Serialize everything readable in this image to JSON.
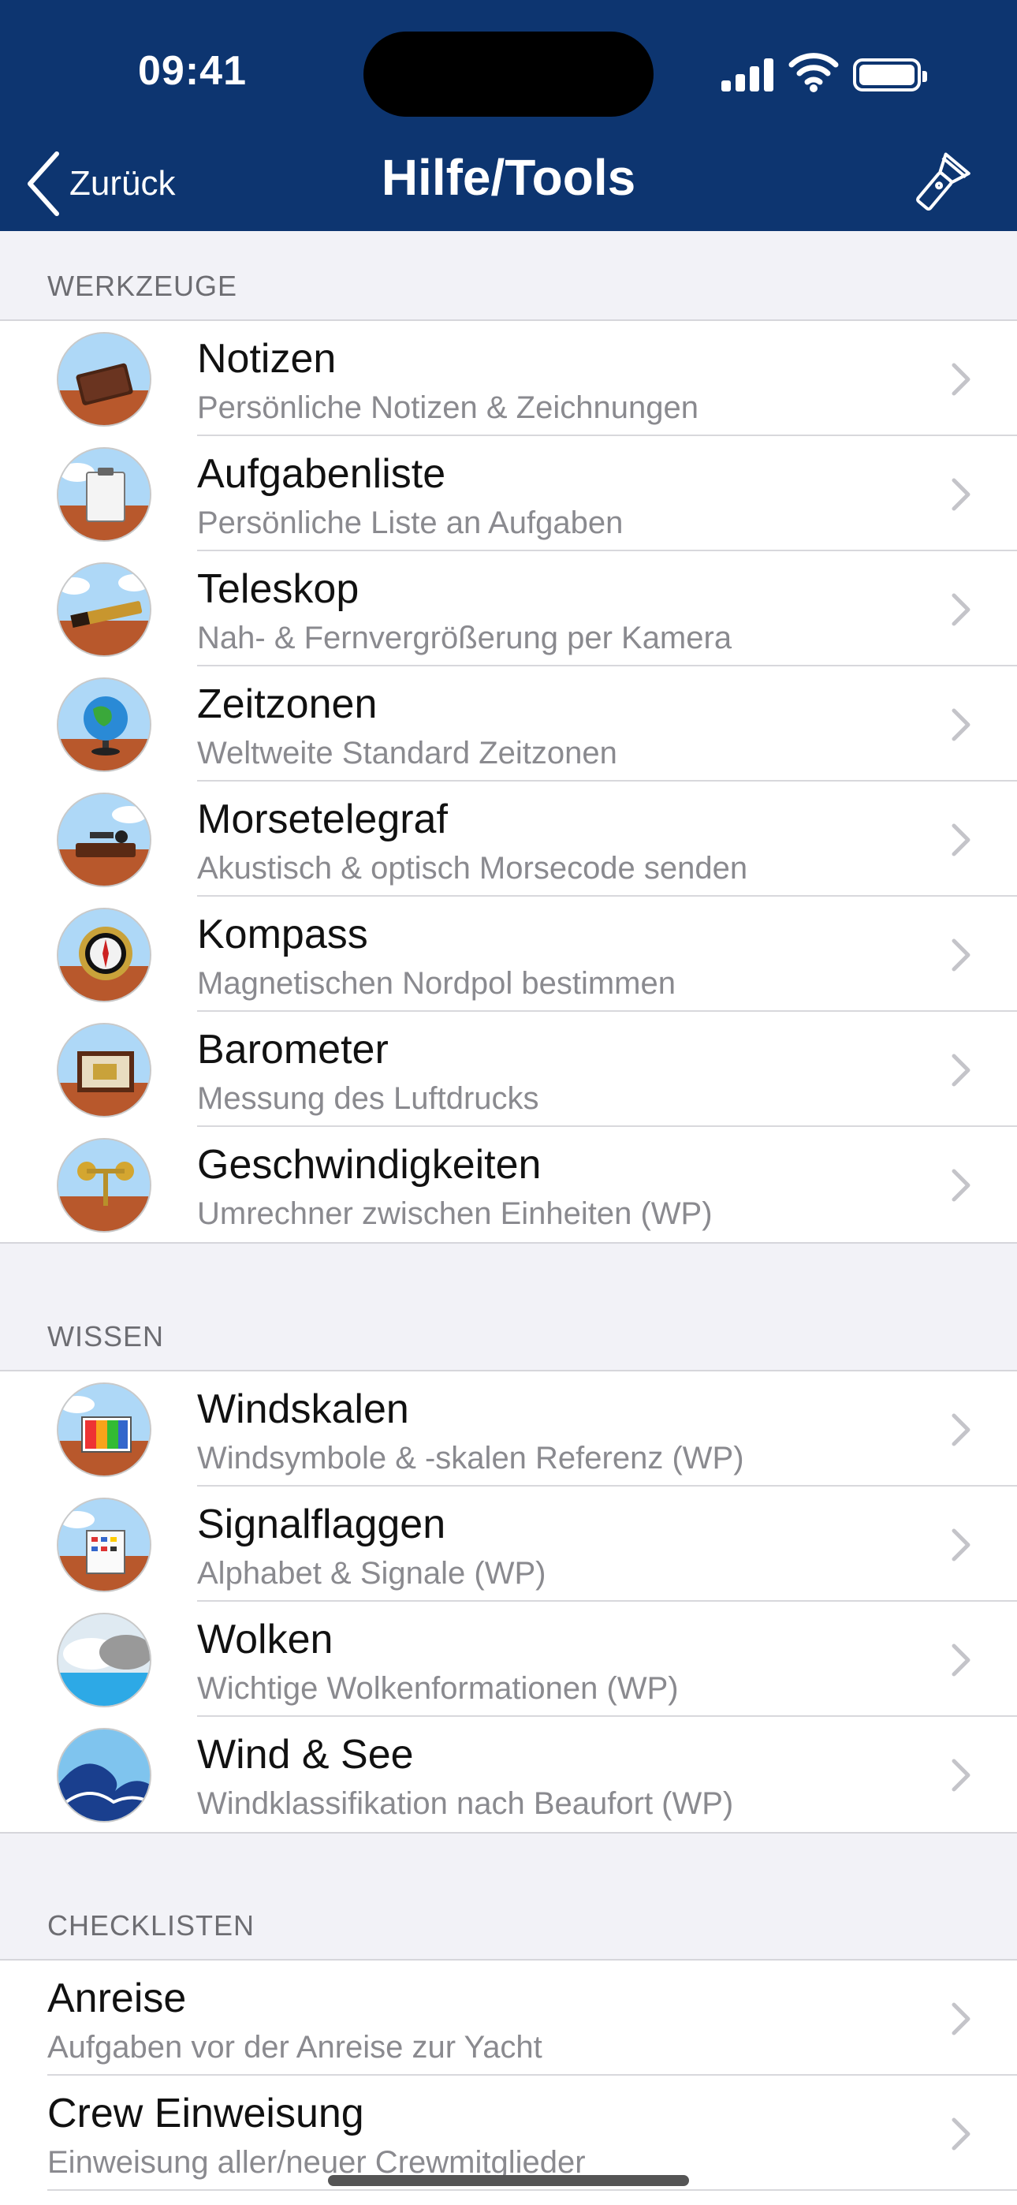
{
  "status": {
    "time": "09:41"
  },
  "nav": {
    "back_label": "Zurück",
    "title": "Hilfe/Tools"
  },
  "sections": {
    "tools": {
      "header": "WERKZEUGE",
      "items": [
        {
          "title": "Notizen",
          "subtitle": "Persönliche Notizen & Zeichnungen",
          "icon": "notebook-icon"
        },
        {
          "title": "Aufgabenliste",
          "subtitle": "Persönliche Liste an Aufgaben",
          "icon": "clipboard-icon"
        },
        {
          "title": "Teleskop",
          "subtitle": "Nah- & Fernvergrößerung per Kamera",
          "icon": "telescope-icon"
        },
        {
          "title": "Zeitzonen",
          "subtitle": "Weltweite Standard Zeitzonen",
          "icon": "globe-icon"
        },
        {
          "title": "Morsetelegraf",
          "subtitle": "Akustisch & optisch Morsecode senden",
          "icon": "telegraph-key-icon"
        },
        {
          "title": "Kompass",
          "subtitle": "Magnetischen Nordpol bestimmen",
          "icon": "compass-icon"
        },
        {
          "title": "Barometer",
          "subtitle": "Messung des Luftdrucks",
          "icon": "barometer-icon"
        },
        {
          "title": "Geschwindigkeiten",
          "subtitle": "Umrechner zwischen Einheiten (WP)",
          "icon": "anemometer-icon"
        }
      ]
    },
    "knowledge": {
      "header": "WISSEN",
      "items": [
        {
          "title": "Windskalen",
          "subtitle": "Windsymbole & -skalen Referenz (WP)",
          "icon": "wind-scale-icon"
        },
        {
          "title": "Signalflaggen",
          "subtitle": "Alphabet & Signale (WP)",
          "icon": "signal-flags-icon"
        },
        {
          "title": "Wolken",
          "subtitle": "Wichtige Wolkenformationen (WP)",
          "icon": "clouds-icon"
        },
        {
          "title": "Wind & See",
          "subtitle": "Windklassifikation nach Beaufort (WP)",
          "icon": "wave-icon"
        }
      ]
    },
    "checklists": {
      "header": "CHECKLISTEN",
      "items": [
        {
          "title": "Anreise",
          "subtitle": "Aufgaben vor der Anreise zur Yacht"
        },
        {
          "title": "Crew Einweisung",
          "subtitle": "Einweisung aller/neuer Crewmitglieder"
        }
      ]
    }
  },
  "colors": {
    "nav_bar": "#0d3570",
    "background": "#f2f2f7",
    "subtitle": "#8a8a8f"
  }
}
